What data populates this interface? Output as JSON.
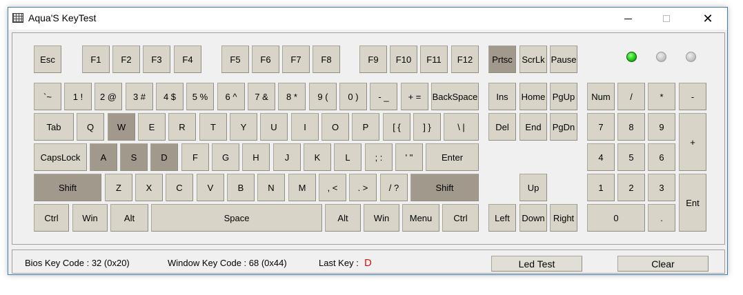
{
  "window": {
    "title": "Aqua'S KeyTest"
  },
  "keys": {
    "esc": "Esc",
    "f1": "F1",
    "f2": "F2",
    "f3": "F3",
    "f4": "F4",
    "f5": "F5",
    "f6": "F6",
    "f7": "F7",
    "f8": "F8",
    "f9": "F9",
    "f10": "F10",
    "f11": "F11",
    "f12": "F12",
    "prtsc": "Prtsc",
    "scrlk": "ScrLk",
    "pause": "Pause",
    "backtick": "`~",
    "n1": "1 !",
    "n2": "2 @",
    "n3": "3 #",
    "n4": "4 $",
    "n5": "5 %",
    "n6": "6 ^",
    "n7": "7 &",
    "n8": "8 *",
    "n9": "9 (",
    "n0": "0 )",
    "minus": "- _",
    "equal": "+ =",
    "backspace": "BackSpace",
    "ins": "Ins",
    "home": "Home",
    "pgup": "PgUp",
    "num": "Num",
    "np_div": "/",
    "np_mul": "*",
    "np_sub": "-",
    "tab": "Tab",
    "q": "Q",
    "w": "W",
    "e": "E",
    "r": "R",
    "t": "T",
    "y": "Y",
    "u": "U",
    "i": "I",
    "o": "O",
    "p": "P",
    "lbr": "[ {",
    "rbr": "] }",
    "bslash": "\\ |",
    "del": "Del",
    "end": "End",
    "pgdn": "PgDn",
    "np7": "7",
    "np8": "8",
    "np9": "9",
    "np_add": "+",
    "caps": "CapsLock",
    "a": "A",
    "s": "S",
    "d": "D",
    "f": "F",
    "g": "G",
    "h": "H",
    "j": "J",
    "k": "K",
    "l": "L",
    "semi": "; :",
    "quote": "' \"",
    "enter": "Enter",
    "np4": "4",
    "np5": "5",
    "np6": "6",
    "lshift": "Shift",
    "z": "Z",
    "x": "X",
    "c": "C",
    "v": "V",
    "b": "B",
    "n": "N",
    "m": "M",
    "comma": ", <",
    "period": ". >",
    "slash": "/ ?",
    "rshift": "Shift",
    "up": "Up",
    "np1": "1",
    "np2": "2",
    "np3": "3",
    "np_ent": "Ent",
    "lctrl": "Ctrl",
    "lwin": "Win",
    "lalt": "Alt",
    "space": "Space",
    "ralt": "Alt",
    "rwin": "Win",
    "menu": "Menu",
    "rctrl": "Ctrl",
    "left": "Left",
    "down": "Down",
    "right": "Right",
    "np0": "0",
    "np_dot": "."
  },
  "pressed_keys": [
    "prtsc",
    "w",
    "a",
    "s",
    "d",
    "lshift",
    "rshift"
  ],
  "leds": [
    {
      "name": "num-lock",
      "state": "on",
      "color": "#19c411"
    },
    {
      "name": "caps-lock",
      "state": "off",
      "color": "#c4c4c4"
    },
    {
      "name": "scroll-lock",
      "state": "off",
      "color": "#c4c4c4"
    }
  ],
  "status": {
    "bios_code": "Bios Key Code : 32 (0x20)",
    "window_code": "Window Key Code : 68 (0x44)",
    "last_key_label": "Last Key :",
    "last_key_value": "D",
    "led_test": "Led Test",
    "clear": "Clear"
  }
}
